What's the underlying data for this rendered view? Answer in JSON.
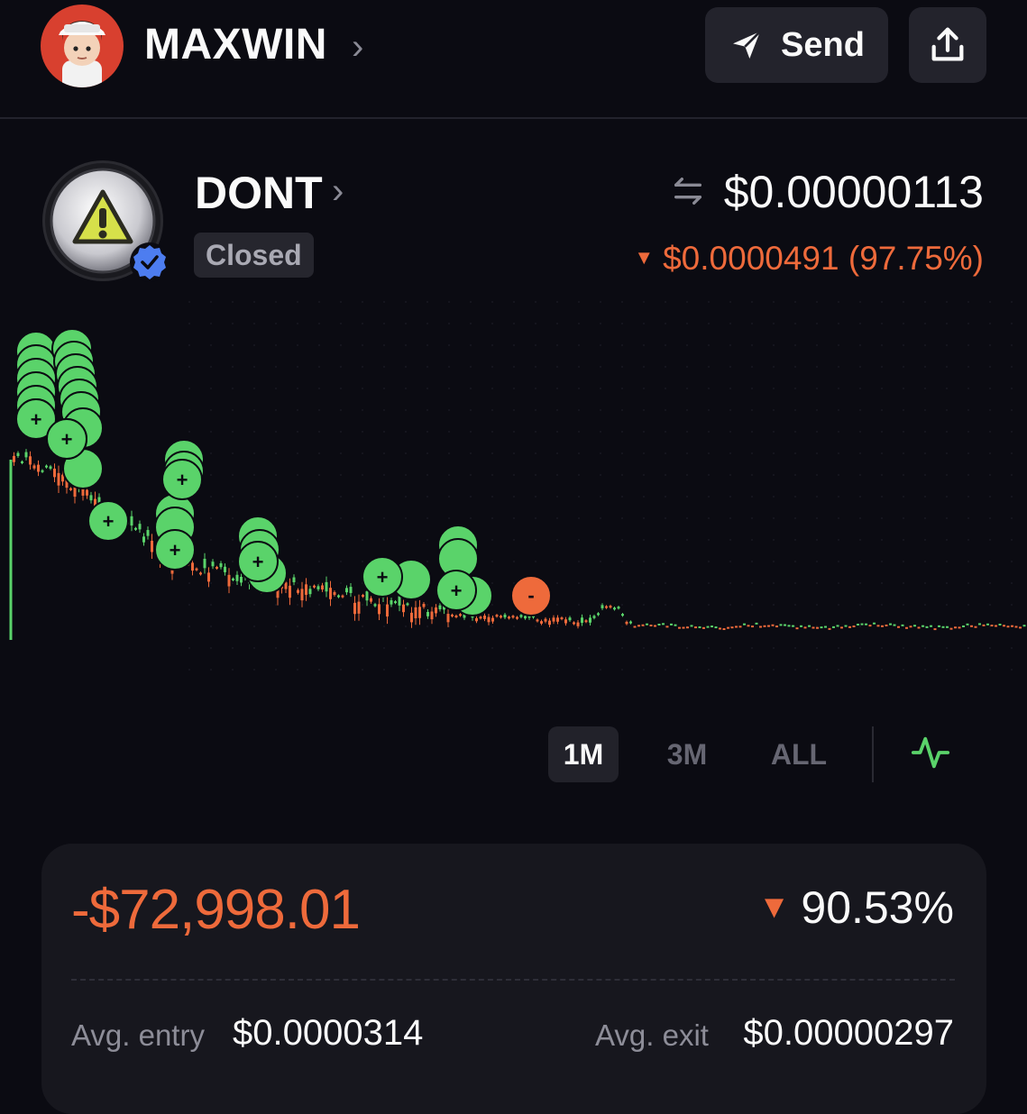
{
  "header": {
    "user_name": "MAXWIN",
    "send_label": "Send",
    "icons": [
      "avatar",
      "chevron-right-icon",
      "send-icon",
      "share-icon"
    ]
  },
  "token": {
    "name": "DONT",
    "status": "Closed",
    "price": "$0.00000113",
    "change": "$0.0000491 (97.75%)",
    "change_color": "#ee6a3b",
    "icons": [
      "warning-icon",
      "verified-icon",
      "swap-icon"
    ]
  },
  "chart_data": {
    "type": "candlestick",
    "description_series": "price",
    "up_color": "#5ad36a",
    "down_color": "#ee6a3b",
    "trade_markers": {
      "buy_symbol": "+",
      "sell_symbol": "-"
    }
  },
  "ranges": {
    "items": [
      "1M",
      "3M",
      "ALL"
    ],
    "selected": "1M"
  },
  "position": {
    "pnl": "-$72,998.01",
    "pnl_percent": "90.53%",
    "avg_entry_label": "Avg. entry",
    "avg_entry": "$0.0000314",
    "avg_exit_label": "Avg. exit",
    "avg_exit": "$0.00000297"
  },
  "colors": {
    "background": "#0b0b12",
    "accent_negative": "#ee6a3b",
    "accent_positive": "#5ad36a"
  }
}
